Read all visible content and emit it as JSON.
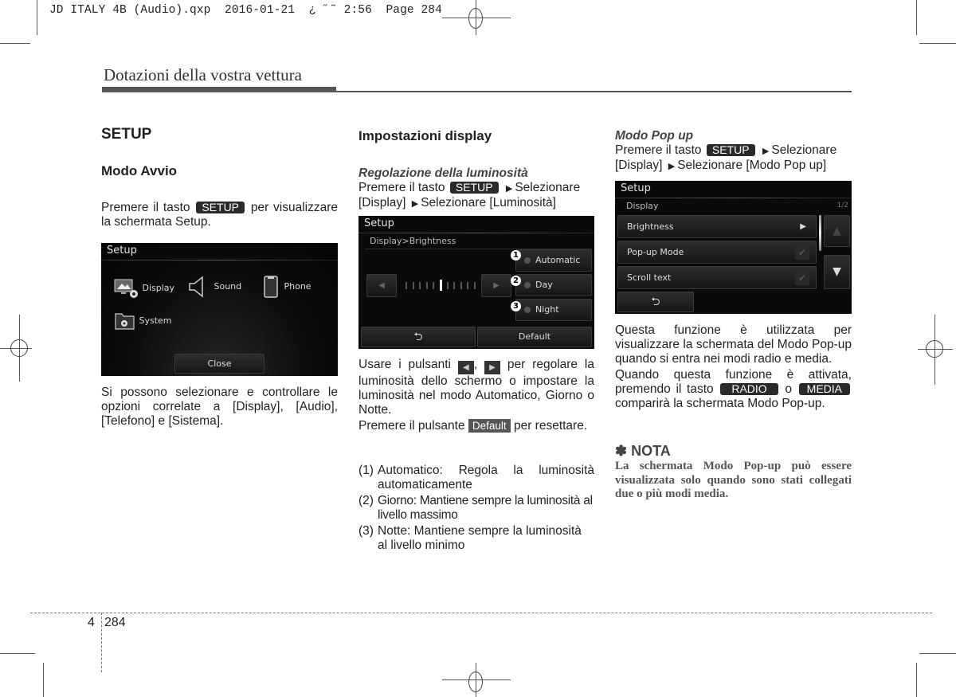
{
  "print_slug": "JD ITALY 4B (Audio).qxp  2016-01-21  ¿ ˝˜ 2:56  Page 284",
  "header": {
    "section_title": "Dotazioni della vostra vettura"
  },
  "col1": {
    "title": "SETUP",
    "subtitle": "Modo Avvio",
    "intro_pre": "Premere il tasto",
    "intro_key": "SETUP",
    "intro_post": "per visualizzare la schermata Setup.",
    "screen": {
      "title": "Setup",
      "items": [
        {
          "label": "Display",
          "icon": "display-settings-icon"
        },
        {
          "label": "Sound",
          "icon": "speaker-icon"
        },
        {
          "label": "Phone",
          "icon": "phone-icon"
        },
        {
          "label": "System",
          "icon": "system-folder-icon"
        }
      ],
      "close_label": "Close"
    },
    "description": "Si possono selezionare e controllare le opzioni correlate a [Display], [Audio], [Telefono] e [Sistema]."
  },
  "col2": {
    "title": "Impostazioni display",
    "subhead": "Regolazione della luminosità",
    "step_pre": "Premere il tasto",
    "step_key": "SETUP",
    "step_sel1": "Selezionare [Display]",
    "step_sel2": "Selezionare [Luminosità]",
    "screen": {
      "title": "Setup",
      "breadcrumb": "Display>Brightness",
      "modes": [
        {
          "num": "1",
          "label": "Automatic"
        },
        {
          "num": "2",
          "label": "Day"
        },
        {
          "num": "3",
          "label": "Night"
        }
      ],
      "slider": {
        "ticks": 11,
        "level": 6
      },
      "back_icon": "back-arrow-icon",
      "default_label": "Default"
    },
    "usage_pre": "Usare i pulsanti",
    "usage_sep": ",",
    "usage_post": "per regolare la luminosità dello schermo o impostare la luminosità nel modo Automatico, Giorno o Notte.",
    "reset_pre": "Premere il pulsante",
    "reset_key": "Default",
    "reset_post": "per resettare.",
    "list": [
      {
        "num": "(1)",
        "text": "Automatico: Regola la luminosità automaticamente"
      },
      {
        "num": "(2)",
        "text": "Giorno: Mantiene sempre la luminosità al livello massimo"
      },
      {
        "num": "(3)",
        "text": "Notte: Mantiene sempre la luminosità al livello minimo"
      }
    ]
  },
  "col3": {
    "subhead": "Modo Pop up",
    "step_pre": "Premere il tasto",
    "step_key": "SETUP",
    "step_sel1": "Selezionare [Display]",
    "step_sel2": "Selezionare [Modo Pop up]",
    "screen": {
      "title": "Setup",
      "subtitle": "Display",
      "page": "1/2",
      "rows": [
        {
          "label": "Brightness",
          "control": "arrow"
        },
        {
          "label": "Pop-up Mode",
          "control": "check"
        },
        {
          "label": "Scroll text",
          "control": "check"
        }
      ]
    },
    "para1": "Questa funzione è utilizzata per visualizzare la schermata del Modo Pop-up quando si entra nei modi radio e media.",
    "para2_pre": "Quando questa funzione è attivata, premendo il tasto",
    "para2_key1": "RADIO",
    "para2_mid": "o",
    "para2_key2": "MEDIA",
    "para2_post": "comparirà la schermata Modo Pop-up.",
    "note_title": "✽ NOTA",
    "note_text": "La schermata Modo Pop-up può essere visualizzata solo quando sono stati collegati due o più modi media."
  },
  "footer": {
    "chapter": "4",
    "page": "284"
  }
}
